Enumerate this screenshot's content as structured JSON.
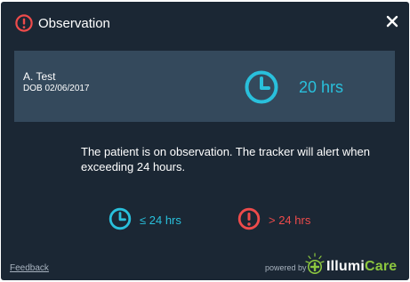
{
  "dialog": {
    "title": "Observation",
    "close_label": "✕"
  },
  "patient": {
    "name": "A. Test",
    "dob": "DOB 02/06/2017",
    "hours": "20 hrs"
  },
  "message": "The patient is on observation. The tracker will alert when exceeding 24 hours.",
  "legend": {
    "under_label": "≤ 24 hrs",
    "over_label": "> 24 hrs"
  },
  "footer": {
    "feedback_label": "Feedback",
    "powered_by": "powered by",
    "brand_part1": "Illumi",
    "brand_part2": "Care"
  },
  "colors": {
    "background": "#1b2734",
    "card": "#34495c",
    "accent_cyan": "#29c0dc",
    "alert_red": "#ee4b4b",
    "brand_green": "#8cc63f"
  },
  "icons": {
    "title": "alert-circle-icon",
    "close": "close-icon",
    "card": "clock-icon",
    "legend_under": "clock-icon",
    "legend_over": "alert-circle-icon",
    "brand": "illumicare-logo"
  }
}
